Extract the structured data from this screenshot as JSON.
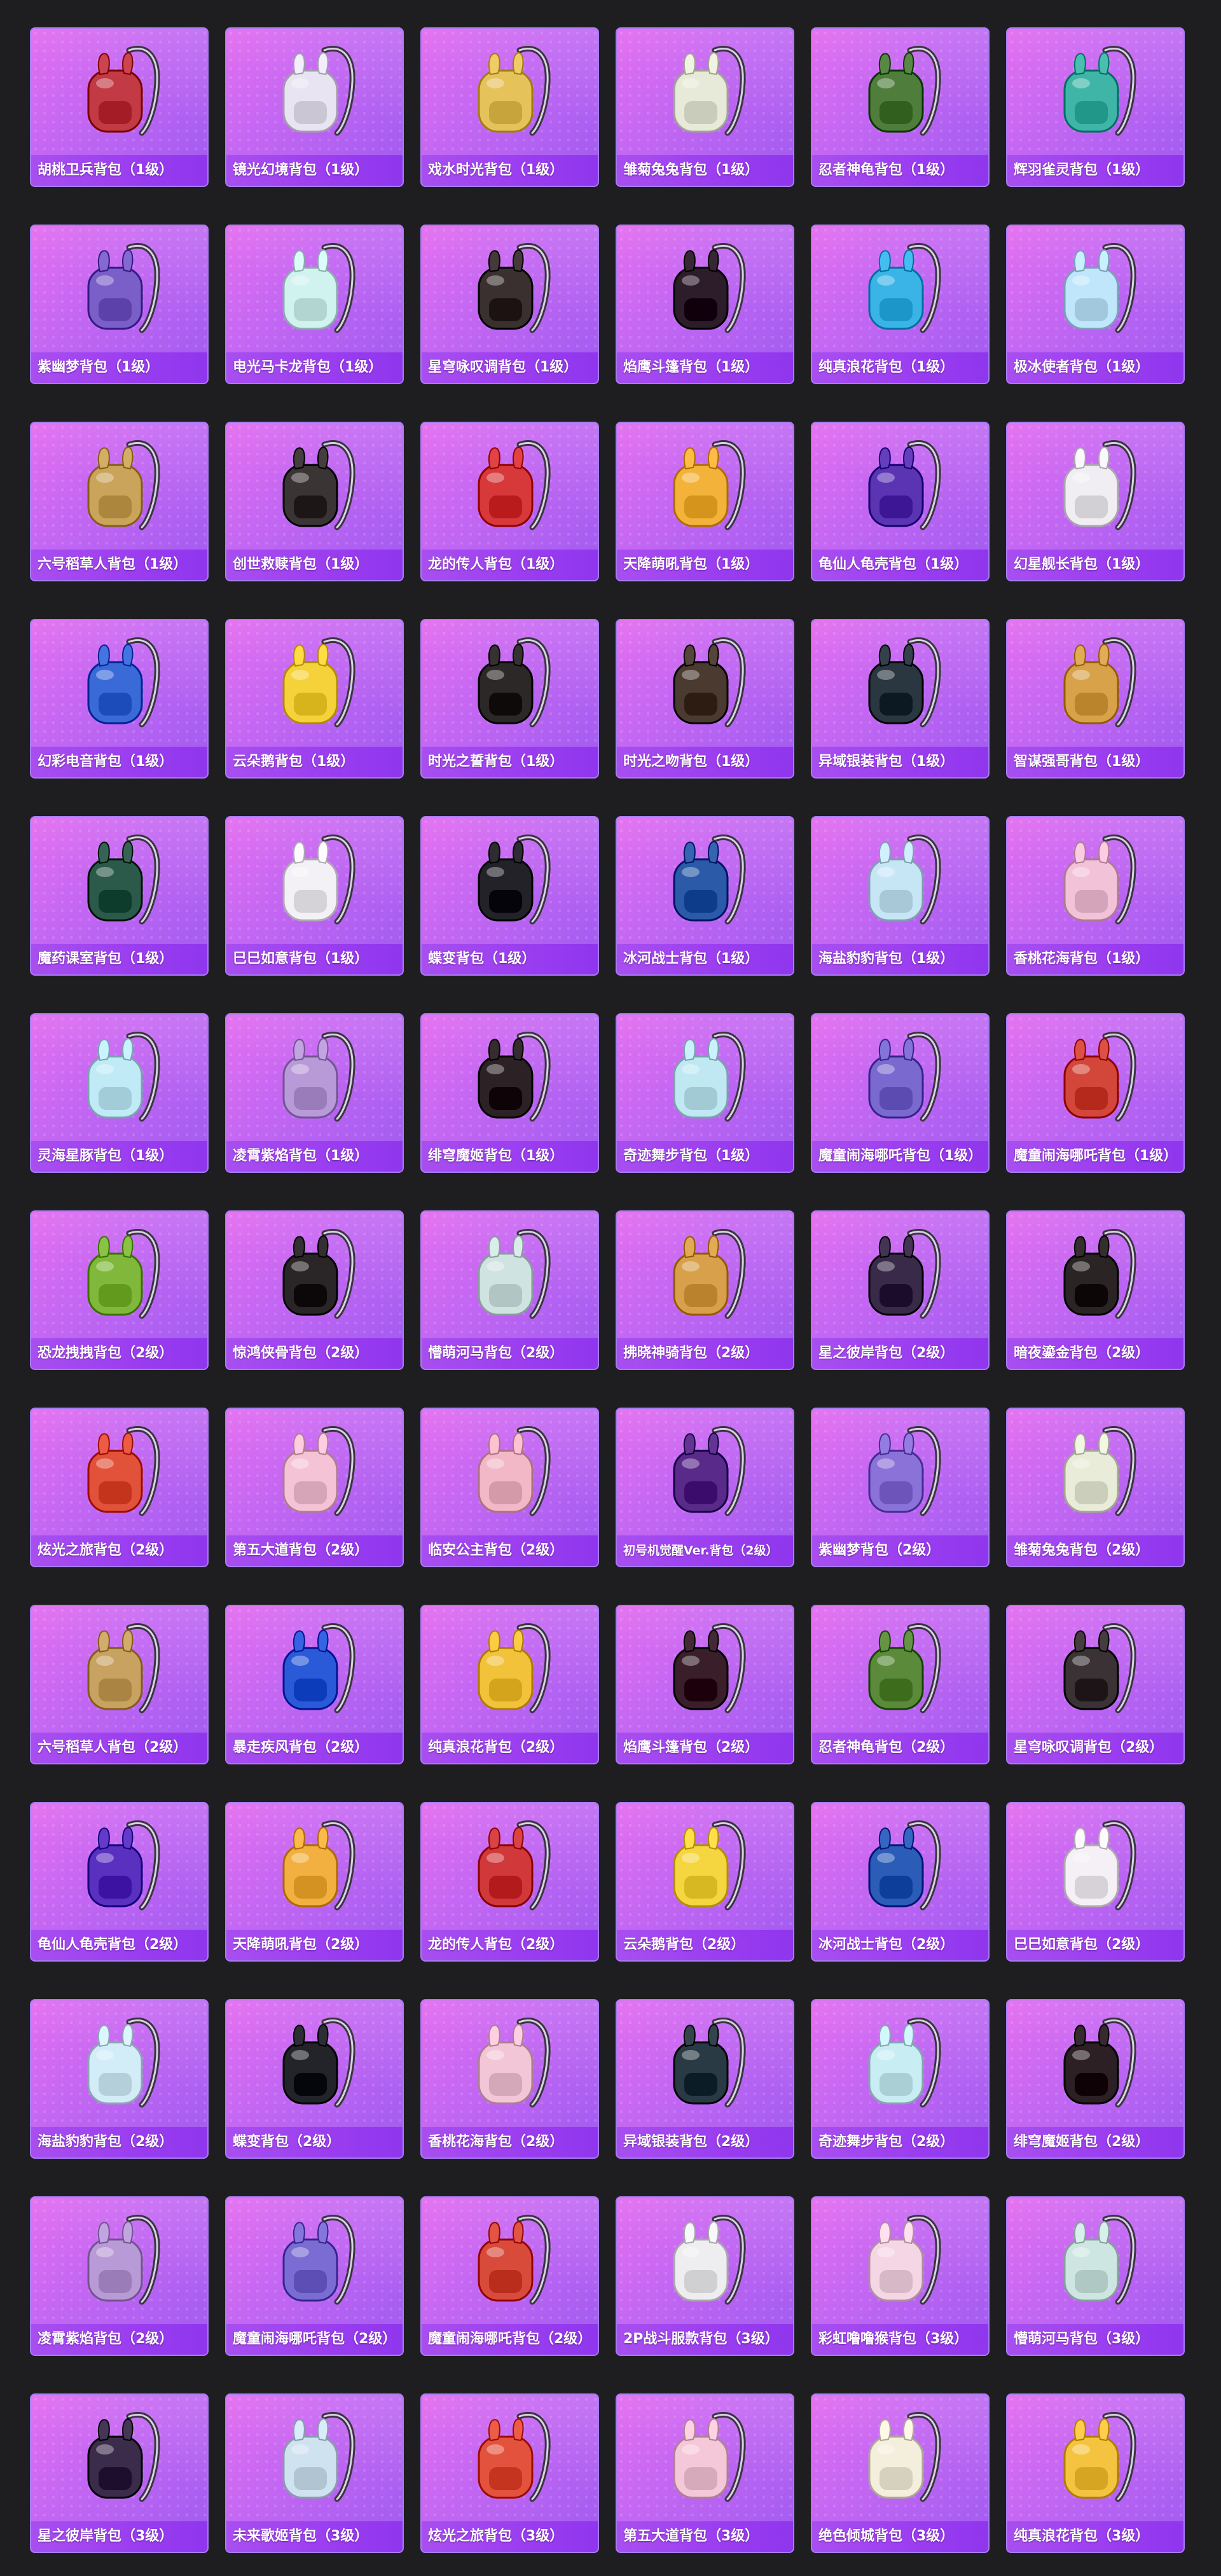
{
  "page": {
    "background": "#1e1e20",
    "card_gradient": [
      "#e46ff0",
      "#9f5bf0"
    ],
    "label_bar_color": "#9a3df0"
  },
  "items": [
    {
      "name": "胡桃卫兵背包（1级）",
      "color": "#c23a44",
      "icon": "backpack-icon"
    },
    {
      "name": "镜光幻境背包（1级）",
      "color": "#e9e4f2",
      "icon": "backpack-icon"
    },
    {
      "name": "戏水时光背包（1级）",
      "color": "#e6c25a",
      "icon": "backpack-icon"
    },
    {
      "name": "雏菊兔兔背包（1级）",
      "color": "#e7ead8",
      "icon": "backpack-icon"
    },
    {
      "name": "忍者神龟背包（1级）",
      "color": "#4f7d3c",
      "icon": "backpack-icon"
    },
    {
      "name": "辉羽雀灵背包（1级）",
      "color": "#3fb5a8",
      "icon": "backpack-icon"
    },
    {
      "name": "紫幽梦背包（1级）",
      "color": "#7a5fc8",
      "icon": "backpack-icon"
    },
    {
      "name": "电光马卡龙背包（1级）",
      "color": "#d0f3f0",
      "icon": "backpack-icon"
    },
    {
      "name": "星穹咏叹调背包（1级）",
      "color": "#3a3030",
      "icon": "backpack-icon"
    },
    {
      "name": "焰鹰斗篷背包（1级）",
      "color": "#2d1d2a",
      "icon": "backpack-icon"
    },
    {
      "name": "纯真浪花背包（1级）",
      "color": "#3ab4e6",
      "icon": "backpack-icon"
    },
    {
      "name": "极冰使者背包（1级）",
      "color": "#bfe6fb",
      "icon": "backpack-icon"
    },
    {
      "name": "六号稻草人背包（1级）",
      "color": "#c9a45a",
      "icon": "backpack-icon"
    },
    {
      "name": "创世救赎背包（1级）",
      "color": "#3a3434",
      "icon": "backpack-icon"
    },
    {
      "name": "龙的传人背包（1级）",
      "color": "#d7383a",
      "icon": "backpack-icon"
    },
    {
      "name": "天降萌吼背包（1级）",
      "color": "#f3b23a",
      "icon": "backpack-icon"
    },
    {
      "name": "龟仙人龟壳背包（1级）",
      "color": "#5b34b4",
      "icon": "backpack-icon"
    },
    {
      "name": "幻星舰长背包（1级）",
      "color": "#f0eef2",
      "icon": "backpack-icon"
    },
    {
      "name": "幻彩电音背包（1级）",
      "color": "#3a6ad8",
      "icon": "backpack-icon"
    },
    {
      "name": "云朵鹅背包（1级）",
      "color": "#f6d23a",
      "icon": "backpack-icon"
    },
    {
      "name": "时光之誓背包（1级）",
      "color": "#2c2828",
      "icon": "backpack-icon"
    },
    {
      "name": "时光之吻背包（1级）",
      "color": "#4a3a30",
      "icon": "backpack-icon"
    },
    {
      "name": "异域银装背包（1级）",
      "color": "#2a3640",
      "icon": "backpack-icon"
    },
    {
      "name": "智谋强哥背包（1级）",
      "color": "#d8a24a",
      "icon": "backpack-icon"
    },
    {
      "name": "魔药课室背包（1级）",
      "color": "#2c5a4a",
      "icon": "backpack-icon"
    },
    {
      "name": "巳巳如意背包（1级）",
      "color": "#f3f1f6",
      "icon": "backpack-icon"
    },
    {
      "name": "蝶变背包（1级）",
      "color": "#222228",
      "icon": "backpack-icon"
    },
    {
      "name": "冰河战士背包（1级）",
      "color": "#2a5aa8",
      "icon": "backpack-icon"
    },
    {
      "name": "海盐豹豹背包（1级）",
      "color": "#c6e6f6",
      "icon": "backpack-icon"
    },
    {
      "name": "香桃花海背包（1级）",
      "color": "#f2c2d8",
      "icon": "backpack-icon"
    },
    {
      "name": "灵海星豚背包（1级）",
      "color": "#bfeaf6",
      "icon": "backpack-icon"
    },
    {
      "name": "凌霄紫焰背包（1级）",
      "color": "#b99ad8",
      "icon": "backpack-icon"
    },
    {
      "name": "绯穹魔姬背包（1级）",
      "color": "#2c2226",
      "icon": "backpack-icon"
    },
    {
      "name": "奇迹舞步背包（1级）",
      "color": "#bfe8f2",
      "icon": "backpack-icon"
    },
    {
      "name": "魔童闹海哪吒背包（1级）",
      "color": "#7a6ad0",
      "icon": "backpack-icon"
    },
    {
      "name": "魔童闹海哪吒背包（1级）",
      "color": "#d2473a",
      "icon": "backpack-icon"
    },
    {
      "name": "恐龙拽拽背包（2级）",
      "color": "#7fb83a",
      "icon": "backpack-icon"
    },
    {
      "name": "惊鸿侠骨背包（2级）",
      "color": "#2a2628",
      "icon": "backpack-icon"
    },
    {
      "name": "懵萌河马背包（2级）",
      "color": "#cfe3e0",
      "icon": "backpack-icon"
    },
    {
      "name": "拂晓神骑背包（2级）",
      "color": "#d8a04a",
      "icon": "backpack-icon"
    },
    {
      "name": "星之彼岸背包（2级）",
      "color": "#3a2a4a",
      "icon": "backpack-icon"
    },
    {
      "name": "暗夜鎏金背包（2级）",
      "color": "#2a2424",
      "icon": "backpack-icon"
    },
    {
      "name": "炫光之旅背包（2级）",
      "color": "#e2523a",
      "icon": "backpack-icon"
    },
    {
      "name": "第五大道背包（2级）",
      "color": "#f4c4d6",
      "icon": "backpack-icon"
    },
    {
      "name": "临安公主背包（2级）",
      "color": "#f2b8c8",
      "icon": "backpack-icon"
    },
    {
      "name": "初号机觉醒Ver.背包（2级）",
      "color": "#5a2a8a",
      "icon": "backpack-icon"
    },
    {
      "name": "紫幽梦背包（2级）",
      "color": "#8a72d8",
      "icon": "backpack-icon"
    },
    {
      "name": "雏菊兔兔背包（2级）",
      "color": "#e8ecd8",
      "icon": "backpack-icon"
    },
    {
      "name": "六号稻草人背包（2级）",
      "color": "#c8a260",
      "icon": "backpack-icon"
    },
    {
      "name": "暴走疾风背包（2级）",
      "color": "#2a5ad8",
      "icon": "backpack-icon"
    },
    {
      "name": "纯真浪花背包（2级）",
      "color": "#f2c23a",
      "icon": "backpack-icon"
    },
    {
      "name": "焰鹰斗篷背包（2级）",
      "color": "#3a1f2a",
      "icon": "backpack-icon"
    },
    {
      "name": "忍者神龟背包（2级）",
      "color": "#5a8a3a",
      "icon": "backpack-icon"
    },
    {
      "name": "星穹咏叹调背包（2级）",
      "color": "#3a3234",
      "icon": "backpack-icon"
    },
    {
      "name": "龟仙人龟壳背包（2级）",
      "color": "#5a30c0",
      "icon": "backpack-icon"
    },
    {
      "name": "天降萌吼背包（2级）",
      "color": "#f2b040",
      "icon": "backpack-icon"
    },
    {
      "name": "龙的传人背包（2级）",
      "color": "#d0383a",
      "icon": "backpack-icon"
    },
    {
      "name": "云朵鹅背包（2级）",
      "color": "#f6d640",
      "icon": "backpack-icon"
    },
    {
      "name": "冰河战士背包（2级）",
      "color": "#2a5cb8",
      "icon": "backpack-icon"
    },
    {
      "name": "巳巳如意背包（2级）",
      "color": "#f4f0f6",
      "icon": "backpack-icon"
    },
    {
      "name": "海盐豹豹背包（2级）",
      "color": "#d2ecf8",
      "icon": "backpack-icon"
    },
    {
      "name": "蝶变背包（2级）",
      "color": "#22242a",
      "icon": "backpack-icon"
    },
    {
      "name": "香桃花海背包（2级）",
      "color": "#f2c6d6",
      "icon": "backpack-icon"
    },
    {
      "name": "异域银装背包（2级）",
      "color": "#2a3a44",
      "icon": "backpack-icon"
    },
    {
      "name": "奇迹舞步背包（2级）",
      "color": "#c8eef4",
      "icon": "backpack-icon"
    },
    {
      "name": "绯穹魔姬背包（2级）",
      "color": "#2c2024",
      "icon": "backpack-icon"
    },
    {
      "name": "凌霄紫焰背包（2级）",
      "color": "#b89ad6",
      "icon": "backpack-icon"
    },
    {
      "name": "魔童闹海哪吒背包（2级）",
      "color": "#7a6cd2",
      "icon": "backpack-icon"
    },
    {
      "name": "魔童闹海哪吒背包（2级）",
      "color": "#d84a3a",
      "icon": "backpack-icon"
    },
    {
      "name": "2P战斗服款背包（3级）",
      "color": "#eeeef0",
      "icon": "backpack-icon"
    },
    {
      "name": "彩虹噜噜猴背包（3级）",
      "color": "#f4d6e4",
      "icon": "backpack-icon"
    },
    {
      "name": "懵萌河马背包（3级）",
      "color": "#cde6e2",
      "icon": "backpack-icon"
    },
    {
      "name": "星之彼岸背包（3级）",
      "color": "#3c2c4c",
      "icon": "backpack-icon"
    },
    {
      "name": "未来歌姬背包（3级）",
      "color": "#cfe2f0",
      "icon": "backpack-icon"
    },
    {
      "name": "炫光之旅背包（3级）",
      "color": "#e2523c",
      "icon": "backpack-icon"
    },
    {
      "name": "第五大道背包（3级）",
      "color": "#f4c8d8",
      "icon": "backpack-icon"
    },
    {
      "name": "绝色倾城背包（3级）",
      "color": "#f4eedc",
      "icon": "backpack-icon"
    },
    {
      "name": "纯真浪花背包（3级）",
      "color": "#f4c440",
      "icon": "backpack-icon"
    }
  ]
}
